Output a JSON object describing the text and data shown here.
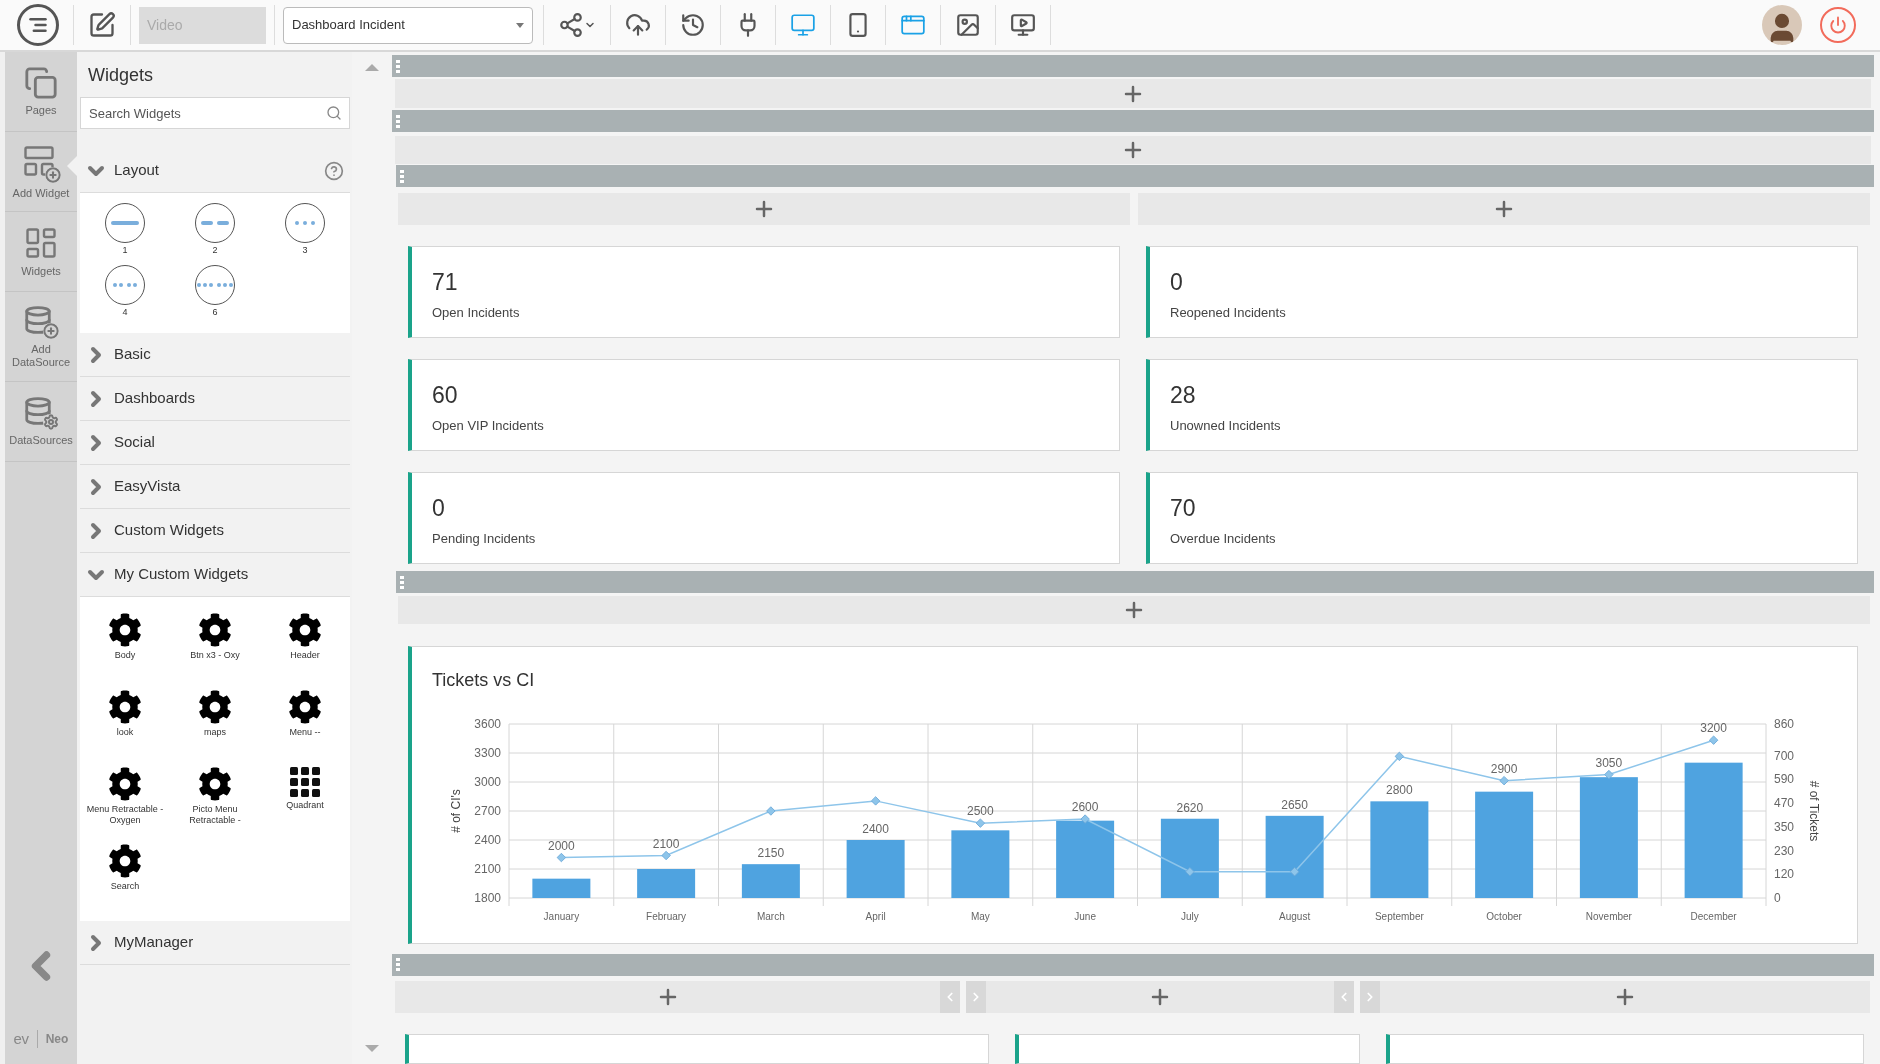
{
  "toolbar": {
    "video_field": {
      "placeholder": "Video",
      "disabled": true
    },
    "dashboard_select": {
      "value": "Dashboard Incident"
    },
    "tools": [
      {
        "kind": "share",
        "active": false
      },
      {
        "kind": "upload",
        "active": false
      },
      {
        "kind": "history",
        "active": false
      },
      {
        "kind": "plug",
        "active": false
      },
      {
        "kind": "desktop",
        "active": true
      },
      {
        "kind": "phone",
        "active": false
      },
      {
        "kind": "edit-layout",
        "active": true
      },
      {
        "kind": "image",
        "active": false
      },
      {
        "kind": "preview",
        "active": false
      }
    ]
  },
  "rail": {
    "items": [
      {
        "kind": "pages",
        "label": "Pages",
        "selected": false
      },
      {
        "kind": "add-widget",
        "label": "Add Widget",
        "selected": true
      },
      {
        "kind": "widgets",
        "label": "Widgets",
        "selected": false
      },
      {
        "kind": "add-datasource",
        "label": "Add DataSource",
        "selected": false
      },
      {
        "kind": "datasources",
        "label": "DataSources",
        "selected": false
      }
    ],
    "logo": {
      "mark": "ev",
      "name": "Neo"
    }
  },
  "panel": {
    "title": "Widgets",
    "search": {
      "placeholder": "Search Widgets"
    },
    "sections": [
      {
        "label": "Layout",
        "expanded": true,
        "help": true,
        "items": [
          {
            "kind": "one-column",
            "label": "1"
          },
          {
            "kind": "two-column",
            "label": "2"
          },
          {
            "kind": "three-column",
            "label": "3"
          },
          {
            "kind": "four-column",
            "label": "4"
          },
          {
            "kind": "six-column",
            "label": "6"
          }
        ]
      },
      {
        "label": "Basic",
        "expanded": false
      },
      {
        "label": "Dashboards",
        "expanded": false
      },
      {
        "label": "Social",
        "expanded": false
      },
      {
        "label": "EasyVista",
        "expanded": false
      },
      {
        "label": "Custom Widgets",
        "expanded": false
      },
      {
        "label": "My Custom Widgets",
        "expanded": true,
        "items": [
          {
            "kind": "gear",
            "label": "Body"
          },
          {
            "kind": "gear",
            "label": "Btn x3 - Oxy"
          },
          {
            "kind": "gear",
            "label": "Header"
          },
          {
            "kind": "gear",
            "label": "look"
          },
          {
            "kind": "gear",
            "label": "maps"
          },
          {
            "kind": "gear",
            "label": "Menu --"
          },
          {
            "kind": "gear",
            "label": "Menu Retractable - Oxygen"
          },
          {
            "kind": "gear",
            "label": "Picto Menu Retractable -"
          },
          {
            "kind": "grid",
            "label": "Quadrant"
          },
          {
            "kind": "gear",
            "label": "Search"
          }
        ]
      },
      {
        "label": "MyManager",
        "expanded": false
      }
    ]
  },
  "kpi_cards": [
    {
      "value": "71",
      "label": "Open Incidents"
    },
    {
      "value": "0",
      "label": "Reopened Incidents"
    },
    {
      "value": "60",
      "label": "Open VIP Incidents"
    },
    {
      "value": "28",
      "label": "Unowned Incidents"
    },
    {
      "value": "0",
      "label": "Pending Incidents"
    },
    {
      "value": "70",
      "label": "Overdue Incidents"
    }
  ],
  "chart": {
    "title": "Tickets vs CI",
    "chart_data": {
      "type": "bar",
      "categories": [
        "January",
        "February",
        "March",
        "April",
        "May",
        "June",
        "July",
        "August",
        "September",
        "October",
        "November",
        "December"
      ],
      "series": [
        {
          "color": "#4fa3e0",
          "values": [
            2000,
            2100,
            2150,
            2400,
            2500,
            2600,
            2620,
            2650,
            2800,
            2900,
            3050,
            3200
          ]
        },
        {
          "type": "line",
          "axis": "y2",
          "marker": "diamond",
          "color": "#8ec5ea",
          "values": [
            200,
            210,
            430,
            480,
            370,
            390,
            130,
            130,
            700,
            580,
            610,
            780
          ]
        }
      ],
      "ylabel": "# of CI's",
      "y2label": "# of Tickets",
      "ylim": [
        1800,
        3600
      ],
      "yticks": [
        1800,
        2100,
        2400,
        2700,
        3000,
        3300,
        3600
      ],
      "y2lim": [
        0,
        860
      ],
      "y2ticks": [
        0,
        120,
        230,
        350,
        470,
        590,
        700,
        860
      ],
      "grid": true,
      "value_labels": [
        [
          "2000",
          "2100",
          "2150",
          "2400",
          "2500",
          "2600",
          "2620",
          "2650",
          "2800",
          "2900",
          "3050",
          "3200"
        ],
        [
          null,
          null,
          null,
          null,
          null,
          null,
          null,
          null,
          null,
          null,
          null,
          null
        ]
      ]
    }
  }
}
